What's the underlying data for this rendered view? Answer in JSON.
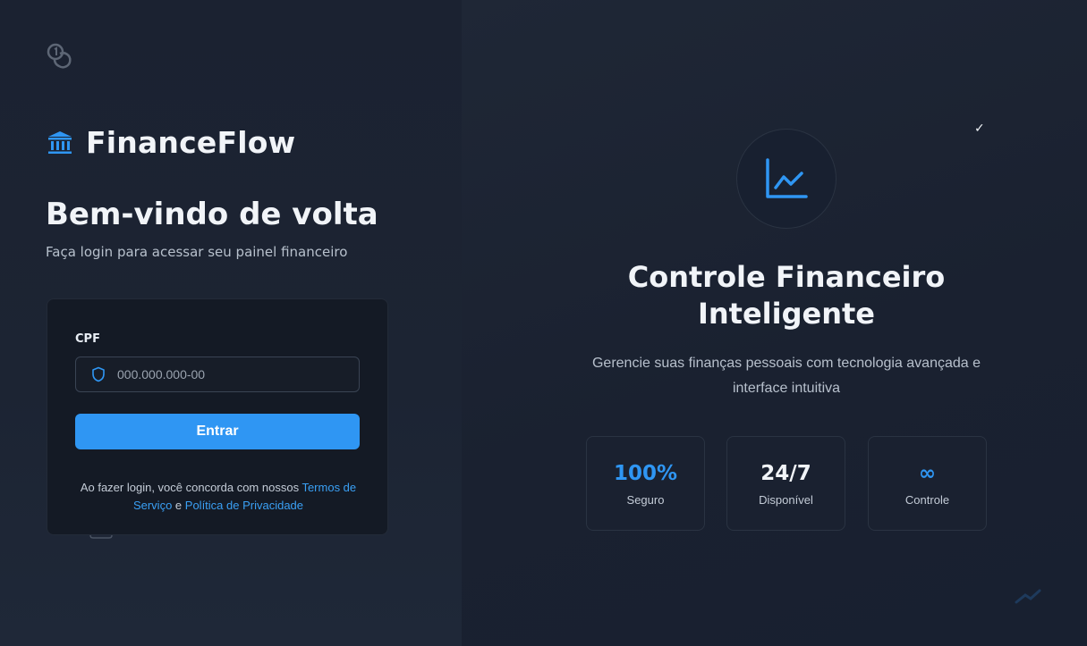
{
  "brand": {
    "name": "FinanceFlow",
    "icon": "bank-icon"
  },
  "login": {
    "title": "Bem-vindo de volta",
    "subtitle": "Faça login para acessar seu painel financeiro",
    "cpf_label": "CPF",
    "cpf_placeholder": "000.000.000-00",
    "cpf_value": "",
    "submit_label": "Entrar",
    "terms_prefix": "Ao fazer login, você concorda com nossos ",
    "terms_link": "Termos de Serviço",
    "terms_middle": " e ",
    "privacy_link": "Política de Privacidade"
  },
  "hero": {
    "check": "✓",
    "title_line1": "Controle Financeiro",
    "title_line2": "Inteligente",
    "description": "Gerencie suas finanças pessoais com tecnologia avançada e interface intuitiva",
    "stats": [
      {
        "value": "100%",
        "label": "Seguro"
      },
      {
        "value": "24/7",
        "label": "Disponível"
      },
      {
        "value": "∞",
        "label": "Controle"
      }
    ]
  },
  "colors": {
    "accent": "#2f96f3",
    "background_left": "#1b2231",
    "background_right": "#1a2130",
    "card": "#141a25"
  }
}
